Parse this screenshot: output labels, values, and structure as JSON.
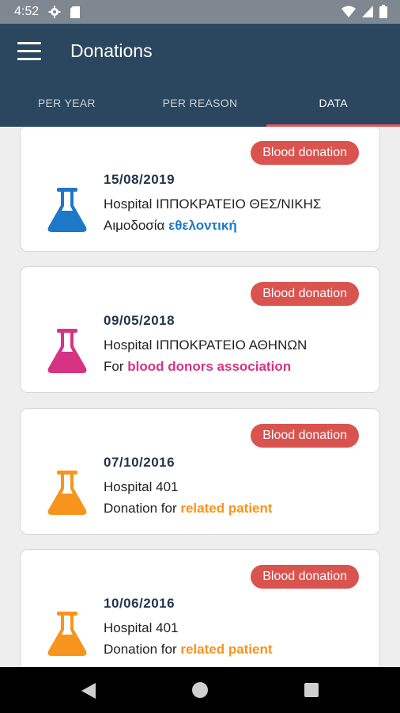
{
  "status_bar": {
    "time": "4:52"
  },
  "app_bar": {
    "title": "Donations"
  },
  "tabs": [
    {
      "label": "PER YEAR",
      "active": false
    },
    {
      "label": "PER REASON",
      "active": false
    },
    {
      "label": "DATA",
      "active": true
    }
  ],
  "donations": [
    {
      "badge": "Blood donation",
      "date": "15/08/2019",
      "hospital": "Hospital ΙΠΠΟΚΡΑΤΕΙΟ ΘΕΣ/ΝΙΚΗΣ",
      "reason_prefix": "Αιμοδοσία",
      "reason_highlight": "εθελοντική",
      "accent_color": "#1e78c8"
    },
    {
      "badge": "Blood donation",
      "date": "09/05/2018",
      "hospital": "Hospital ΙΠΠΟΚΡΑΤΕΙΟ ΑΘΗΝΩΝ",
      "reason_prefix": "For",
      "reason_highlight": "blood donors association",
      "accent_color": "#d63384"
    },
    {
      "badge": "Blood donation",
      "date": "07/10/2016",
      "hospital": "Hospital 401",
      "reason_prefix": "Donation for",
      "reason_highlight": "related patient",
      "accent_color": "#f7941d"
    },
    {
      "badge": "Blood donation",
      "date": "10/06/2016",
      "hospital": "Hospital 401",
      "reason_prefix": "Donation for",
      "reason_highlight": "related patient",
      "accent_color": "#f7941d"
    }
  ],
  "colors": {
    "app_bar": "#2b475f",
    "badge": "#d9534f",
    "tab_indicator": "#e05a5f",
    "date_text": "#23354d"
  },
  "icons": {
    "menu": "hamburger-menu-icon",
    "flask": "flask-icon",
    "nav_back": "back-triangle-icon",
    "nav_home": "home-circle-icon",
    "nav_recent": "recents-square-icon"
  }
}
